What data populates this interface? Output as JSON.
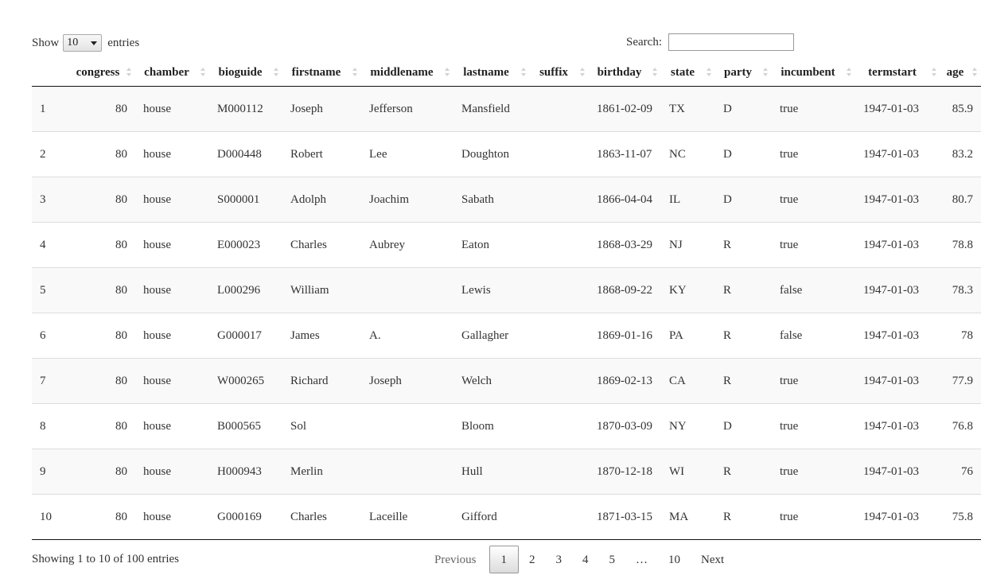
{
  "length_control": {
    "show_label": "Show",
    "selected": "10",
    "entries_label": "entries"
  },
  "search": {
    "label": "Search:",
    "value": "",
    "placeholder": ""
  },
  "table": {
    "columns": [
      "",
      "congress",
      "chamber",
      "bioguide",
      "firstname",
      "middlename",
      "lastname",
      "suffix",
      "birthday",
      "state",
      "party",
      "incumbent",
      "termstart",
      "age"
    ],
    "rows": [
      [
        "1",
        "80",
        "house",
        "M000112",
        "Joseph",
        "Jefferson",
        "Mansfield",
        "",
        "1861-02-09",
        "TX",
        "D",
        "true",
        "1947-01-03",
        "85.9"
      ],
      [
        "2",
        "80",
        "house",
        "D000448",
        "Robert",
        "Lee",
        "Doughton",
        "",
        "1863-11-07",
        "NC",
        "D",
        "true",
        "1947-01-03",
        "83.2"
      ],
      [
        "3",
        "80",
        "house",
        "S000001",
        "Adolph",
        "Joachim",
        "Sabath",
        "",
        "1866-04-04",
        "IL",
        "D",
        "true",
        "1947-01-03",
        "80.7"
      ],
      [
        "4",
        "80",
        "house",
        "E000023",
        "Charles",
        "Aubrey",
        "Eaton",
        "",
        "1868-03-29",
        "NJ",
        "R",
        "true",
        "1947-01-03",
        "78.8"
      ],
      [
        "5",
        "80",
        "house",
        "L000296",
        "William",
        "",
        "Lewis",
        "",
        "1868-09-22",
        "KY",
        "R",
        "false",
        "1947-01-03",
        "78.3"
      ],
      [
        "6",
        "80",
        "house",
        "G000017",
        "James",
        "A.",
        "Gallagher",
        "",
        "1869-01-16",
        "PA",
        "R",
        "false",
        "1947-01-03",
        "78"
      ],
      [
        "7",
        "80",
        "house",
        "W000265",
        "Richard",
        "Joseph",
        "Welch",
        "",
        "1869-02-13",
        "CA",
        "R",
        "true",
        "1947-01-03",
        "77.9"
      ],
      [
        "8",
        "80",
        "house",
        "B000565",
        "Sol",
        "",
        "Bloom",
        "",
        "1870-03-09",
        "NY",
        "D",
        "true",
        "1947-01-03",
        "76.8"
      ],
      [
        "9",
        "80",
        "house",
        "H000943",
        "Merlin",
        "",
        "Hull",
        "",
        "1870-12-18",
        "WI",
        "R",
        "true",
        "1947-01-03",
        "76"
      ],
      [
        "10",
        "80",
        "house",
        "G000169",
        "Charles",
        "Laceille",
        "Gifford",
        "",
        "1871-03-15",
        "MA",
        "R",
        "true",
        "1947-01-03",
        "75.8"
      ]
    ]
  },
  "info": "Showing 1 to 10 of 100 entries",
  "pagination": {
    "previous": "Previous",
    "pages": [
      "1",
      "2",
      "3",
      "4",
      "5"
    ],
    "ellipsis": "…",
    "last": "10",
    "next": "Next",
    "current": "1"
  }
}
